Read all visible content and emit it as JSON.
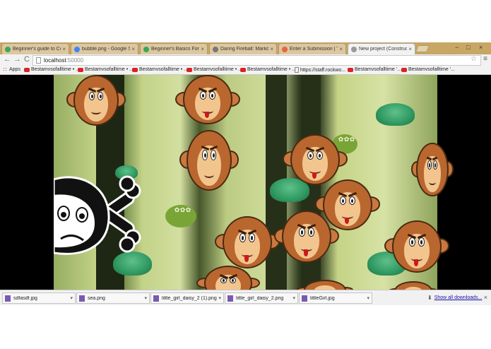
{
  "browser": {
    "tabs": [
      {
        "label": "Beginner's guide to Const",
        "icon_color": "#3aa757"
      },
      {
        "label": "bubble.png - Google Sear",
        "icon_color": "#4285f4"
      },
      {
        "label": "Beginner's Basics For Con",
        "icon_color": "#3aa757"
      },
      {
        "label": "Daring Fireball: Markdow",
        "icon_color": "#777777"
      },
      {
        "label": "Enter a Submission | Tim",
        "icon_color": "#e8663d"
      },
      {
        "label": "New project (Construct 2",
        "icon_color": "#999999"
      }
    ],
    "active_tab": 5,
    "tab_close": "×",
    "window_controls": {
      "minimize": "−",
      "maximize": "□",
      "close": "×"
    },
    "address": {
      "host": "localhost",
      "port": ":50000"
    },
    "nav": {
      "back": "←",
      "forward": "→",
      "reload": "C"
    },
    "star_icon": "☆",
    "menu_icon": "≡"
  },
  "bookmarks": [
    {
      "label": "Apps",
      "icon": "apps-grid-icon"
    },
    {
      "label": "Bestamvsofalltime • ...",
      "icon": "youtube-icon"
    },
    {
      "label": "Bestamvsofalltime • ...",
      "icon": "youtube-icon"
    },
    {
      "label": "Bestamvsofalltime • ...",
      "icon": "youtube-icon"
    },
    {
      "label": "Bestamvsofalltime • ...",
      "icon": "youtube-icon"
    },
    {
      "label": "Bestamvsofalltime • ...",
      "icon": "youtube-icon"
    },
    {
      "label": "https://staff.rockwo...",
      "icon": "page-icon"
    },
    {
      "label": "Bestamvsofalltime '...",
      "icon": "youtube-icon"
    },
    {
      "label": "Bestamvsofalltime '...",
      "icon": "youtube-icon"
    }
  ],
  "game": {
    "monkey_count": 15,
    "skull_icon": "skull-crossbones-monkey",
    "colors": {
      "forest_light": "#d3dfa0",
      "forest_dark": "#263018",
      "monkey_fur": "#b9672f",
      "monkey_face": "#f3c58e",
      "bush": "#2f9961"
    }
  },
  "downloads": {
    "items": [
      {
        "name": "sdfasdf.jpg"
      },
      {
        "name": "sea.png"
      },
      {
        "name": "little_girl_daisy_2 (1).png"
      },
      {
        "name": "little_girl_daisy_2.png"
      },
      {
        "name": "littleGirl.jpg"
      }
    ],
    "item_menu": "▾",
    "show_all": "Show all downloads...",
    "close": "×"
  }
}
